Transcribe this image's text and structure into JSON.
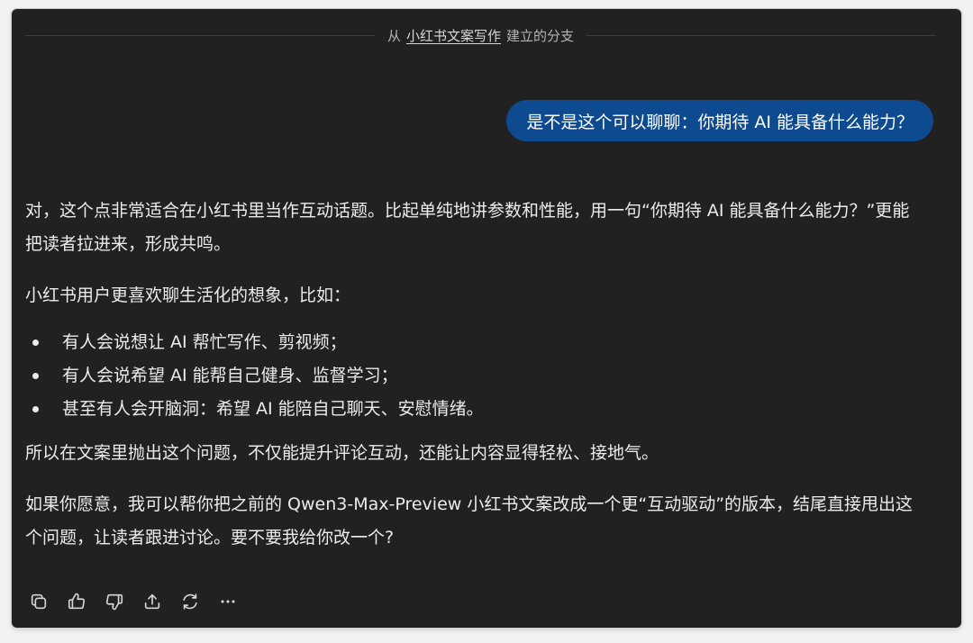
{
  "branch": {
    "prefix": "从",
    "source": "小红书文案写作",
    "suffix": "建立的分支"
  },
  "user_message": "是不是这个可以聊聊：你期待 AI 能具备什么能力？",
  "assistant": {
    "paragraph1": "对，这个点非常适合在小红书里当作互动话题。比起单纯地讲参数和性能，用一句“你期待 AI 能具备什么能力？”更能把读者拉进来，形成共鸣。",
    "paragraph2": "小红书用户更喜欢聊生活化的想象，比如：",
    "bullets": [
      "有人会说想让 AI 帮忙写作、剪视频；",
      "有人会说希望 AI 能帮自己健身、监督学习；",
      "甚至有人会开脑洞：希望 AI 能陪自己聊天、安慰情绪。"
    ],
    "paragraph3": "所以在文案里抛出这个问题，不仅能提升评论互动，还能让内容显得轻松、接地气。",
    "paragraph4": "如果你愿意，我可以帮你把之前的 Qwen3-Max-Preview 小红书文案改成一个更“互动驱动”的版本，结尾直接甩出这个问题，让读者跟进讨论。要不要我给你改一个?"
  },
  "actions": [
    {
      "icon": "copy-icon"
    },
    {
      "icon": "thumbs-up-icon"
    },
    {
      "icon": "thumbs-down-icon"
    },
    {
      "icon": "share-icon"
    },
    {
      "icon": "regenerate-icon"
    },
    {
      "icon": "more-icon"
    }
  ],
  "colors": {
    "background": "#212121",
    "user_bubble": "#0e4a8f",
    "text": "#ececec",
    "muted": "#b4b4b4"
  }
}
